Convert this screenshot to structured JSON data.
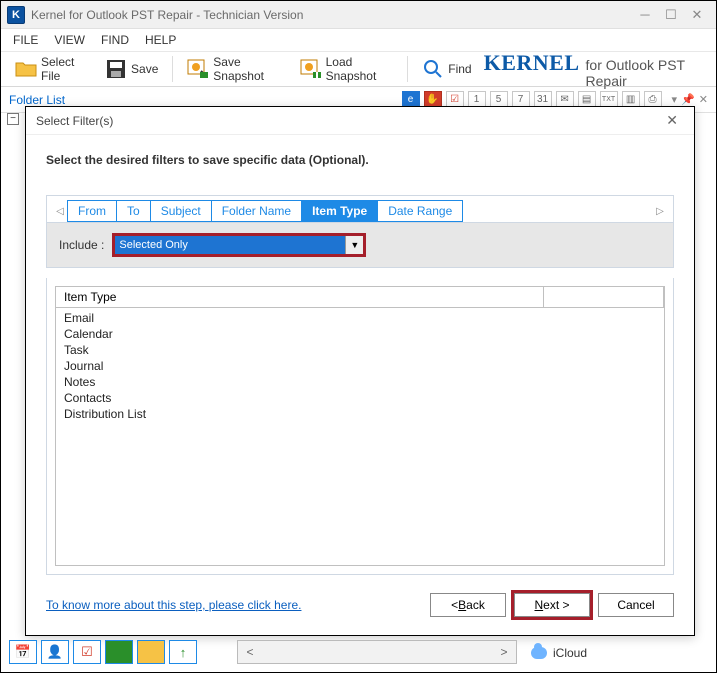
{
  "window": {
    "title": "Kernel for Outlook PST Repair - Technician Version",
    "app_icon_letter": "K"
  },
  "menus": [
    "FILE",
    "VIEW",
    "FIND",
    "HELP"
  ],
  "toolbar": {
    "select_file": "Select File",
    "save": "Save",
    "save_snapshot": "Save Snapshot",
    "load_snapshot": "Load Snapshot",
    "find": "Find"
  },
  "brand": {
    "kernel": "KERNEL",
    "rest": "for Outlook PST Repair"
  },
  "strip": {
    "folder_list_label": "Folder List",
    "mini_labels": [
      "1",
      "5",
      "7",
      "31"
    ]
  },
  "dialog": {
    "title": "Select Filter(s)",
    "heading": "Select the desired filters to save specific data (Optional).",
    "tabs": [
      "From",
      "To",
      "Subject",
      "Folder Name",
      "Item Type",
      "Date Range"
    ],
    "active_tab_index": 4,
    "include_label": "Include :",
    "include_value": "Selected Only",
    "list_header": "Item Type",
    "items": [
      "Email",
      "Calendar",
      "Task",
      "Journal",
      "Notes",
      "Contacts",
      "Distribution List"
    ],
    "help_link": "To know more about this step, please click here.",
    "buttons": {
      "back": "< Back",
      "next": "Next >",
      "cancel": "Cancel"
    }
  },
  "bottom": {
    "icloud": "iCloud"
  }
}
